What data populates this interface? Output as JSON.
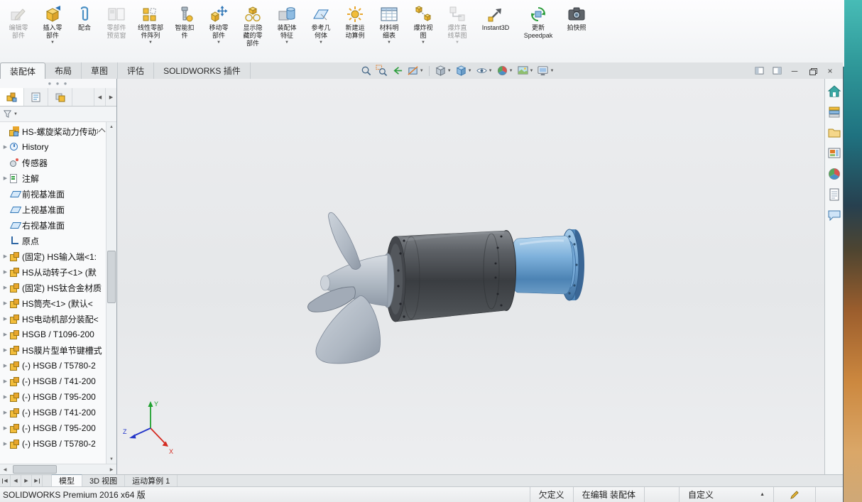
{
  "toolbar": {
    "buttons": [
      {
        "id": "edit-component",
        "label": "编辑零\n部件",
        "disabled": true,
        "dropdown": false
      },
      {
        "id": "insert-component",
        "label": "插入零\n部件",
        "disabled": false,
        "dropdown": true
      },
      {
        "id": "mate",
        "label": "配合",
        "disabled": false,
        "dropdown": false
      },
      {
        "id": "component-preview",
        "label": "零部件\n预览窗",
        "disabled": true,
        "dropdown": false
      },
      {
        "id": "linear-component-pattern",
        "label": "线性零部\n件阵列",
        "disabled": false,
        "dropdown": true
      },
      {
        "id": "smart-fasteners",
        "label": "智能扣\n件",
        "disabled": false,
        "dropdown": false
      },
      {
        "id": "move-component",
        "label": "移动零\n部件",
        "disabled": false,
        "dropdown": true
      },
      {
        "id": "show-hidden-components",
        "label": "显示隐\n藏的零\n部件",
        "disabled": false,
        "dropdown": false
      },
      {
        "id": "assembly-features",
        "label": "装配体\n特征",
        "disabled": false,
        "dropdown": true
      },
      {
        "id": "reference-geometry",
        "label": "参考几\n何体",
        "disabled": false,
        "dropdown": true
      },
      {
        "id": "new-motion-study",
        "label": "新建运\n动算例",
        "disabled": false,
        "dropdown": false
      },
      {
        "id": "bill-of-materials",
        "label": "材料明\n细表",
        "disabled": false,
        "dropdown": true
      },
      {
        "id": "exploded-view",
        "label": "爆炸视\n图",
        "disabled": false,
        "dropdown": true
      },
      {
        "id": "explode-line-sketch",
        "label": "爆炸直\n线草图",
        "disabled": true,
        "dropdown": true
      },
      {
        "id": "instant3d",
        "label": "Instant3D",
        "disabled": false,
        "dropdown": false
      },
      {
        "id": "update-speedpak",
        "label": "更新\nSpeedpak",
        "disabled": false,
        "dropdown": false
      },
      {
        "id": "take-snapshot",
        "label": "拍快照",
        "disabled": false,
        "dropdown": false
      }
    ]
  },
  "ribbon_tabs": {
    "items": [
      {
        "label": "装配体",
        "active": true
      },
      {
        "label": "布局",
        "active": false
      },
      {
        "label": "草图",
        "active": false
      },
      {
        "label": "评估",
        "active": false
      },
      {
        "label": "SOLIDWORKS 插件",
        "active": false
      }
    ]
  },
  "headsup": {
    "tools": [
      "zoom-to-fit",
      "zoom-to-area",
      "previous-view",
      "section-view",
      "view-orientation",
      "display-style",
      "hide-show-items",
      "edit-appearance",
      "apply-scene",
      "view-settings"
    ]
  },
  "feature_tree": {
    "items": [
      {
        "label": "HS-螺旋桨动力传动机构",
        "icon": "assembly",
        "expandable": false
      },
      {
        "label": "History",
        "icon": "history",
        "expandable": true
      },
      {
        "label": "传感器",
        "icon": "sensors",
        "expandable": false
      },
      {
        "label": "注解",
        "icon": "annotations",
        "expandable": true
      },
      {
        "label": "前视基准面",
        "icon": "plane",
        "expandable": false
      },
      {
        "label": "上视基准面",
        "icon": "plane",
        "expandable": false
      },
      {
        "label": "右视基准面",
        "icon": "plane",
        "expandable": false
      },
      {
        "label": "原点",
        "icon": "origin",
        "expandable": false
      },
      {
        "label": "(固定) HS输入端<1:",
        "icon": "component",
        "expandable": true
      },
      {
        "label": "HS从动转子<1> (默",
        "icon": "component",
        "expandable": true
      },
      {
        "label": "(固定) HS钛合金材质",
        "icon": "component",
        "expandable": true
      },
      {
        "label": "HS筒壳<1> (默认<",
        "icon": "component",
        "expandable": true
      },
      {
        "label": "HS电动机部分装配<",
        "icon": "component",
        "expandable": true
      },
      {
        "label": "HSGB / T1096-200",
        "icon": "component",
        "expandable": true
      },
      {
        "label": "HS膜片型单节键槽式",
        "icon": "component",
        "expandable": true
      },
      {
        "label": "(-) HSGB / T5780-2",
        "icon": "component",
        "expandable": true
      },
      {
        "label": "(-) HSGB / T41-200",
        "icon": "component",
        "expandable": true
      },
      {
        "label": "(-) HSGB / T95-200",
        "icon": "component",
        "expandable": true
      },
      {
        "label": "(-) HSGB / T41-200",
        "icon": "component",
        "expandable": true
      },
      {
        "label": "(-) HSGB / T95-200",
        "icon": "component",
        "expandable": true
      },
      {
        "label": "(-) HSGB / T5780-2",
        "icon": "component",
        "expandable": true
      }
    ]
  },
  "viewport": {
    "triad": {
      "x_label": "X",
      "y_label": "Y",
      "z_label": "Z"
    }
  },
  "taskpane": {
    "icons": [
      "solidworks-resources-home",
      "design-library",
      "file-explorer",
      "view-palette",
      "appearances",
      "custom-properties",
      "forum"
    ]
  },
  "bottom_tabs": {
    "items": [
      {
        "label": "模型",
        "active": true
      },
      {
        "label": "3D 视图",
        "active": false
      },
      {
        "label": "运动算例 1",
        "active": false
      }
    ]
  },
  "statusbar": {
    "app_version": "SOLIDWORKS Premium 2016 x64 版",
    "definition_state": "欠定义",
    "editing_state": "在编辑 装配体",
    "units": "自定义"
  },
  "colors": {
    "icon_yellow": "#f2bd3a",
    "accent_blue": "#2e75b6",
    "housing_dark": "#3a3d41",
    "coupling_blue": "#7fb2dc",
    "propeller_gray": "#aeb7c2"
  }
}
